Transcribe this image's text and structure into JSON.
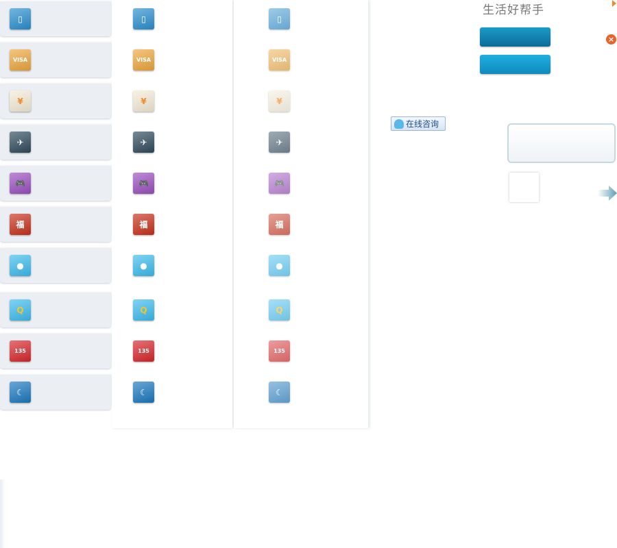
{
  "header": {
    "title": "生活好帮手"
  },
  "consult_button": {
    "label": "在线咨询"
  },
  "icons": [
    {
      "name": "mobile-recharge-icon",
      "color": "#2a8fd0",
      "glyph": "▯"
    },
    {
      "name": "credit-card-icon",
      "color": "#eea73c",
      "glyph": "VISA"
    },
    {
      "name": "house-payment-icon",
      "color": "#f5ecd7",
      "glyph": "¥"
    },
    {
      "name": "flight-icon",
      "color": "#2f4a5c",
      "glyph": "✈"
    },
    {
      "name": "game-controller-icon",
      "color": "#9b4ec0",
      "glyph": "🎮"
    },
    {
      "name": "lottery-fu-icon",
      "color": "#c8301a",
      "glyph": "福"
    },
    {
      "name": "qq-penguin-icon",
      "color": "#3cbcef",
      "glyph": "●"
    },
    {
      "name": "qcoin-icon",
      "color": "#3cbcef",
      "glyph": "Q"
    },
    {
      "name": "number-lottery-icon",
      "color": "#d8262a",
      "glyph": "135"
    },
    {
      "name": "hotel-icon",
      "color": "#1a78c0",
      "glyph": "☾"
    }
  ],
  "colors": {
    "accent_button_dark": "#0c6c98",
    "accent_button_light": "#1db1e0",
    "close": "#e8632a"
  }
}
